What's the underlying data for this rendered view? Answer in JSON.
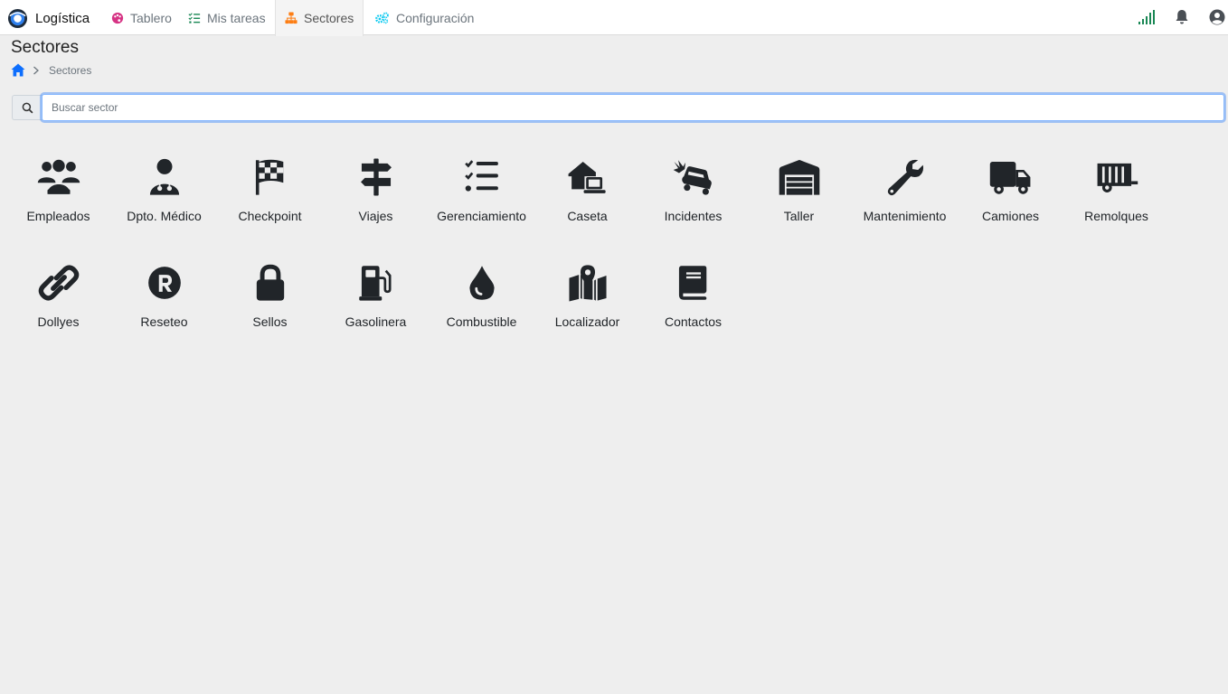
{
  "app": {
    "brand": "Logística",
    "colors": {
      "accent": "#0d6efd",
      "active_tab": "#fd7e14",
      "tablero": "#d63384",
      "tareas": "#198754",
      "config": "#0dcaf0"
    }
  },
  "nav": {
    "tabs": [
      {
        "label": "Tablero",
        "icon": "palette-icon"
      },
      {
        "label": "Mis tareas",
        "icon": "tasks-icon"
      },
      {
        "label": "Sectores",
        "icon": "sitemap-icon"
      },
      {
        "label": "Configuración",
        "icon": "cogs-icon"
      }
    ],
    "active": "Sectores"
  },
  "page": {
    "title": "Sectores",
    "breadcrumb": [
      "Sectores"
    ]
  },
  "search": {
    "placeholder": "Buscar sector",
    "value": ""
  },
  "sectors": [
    {
      "label": "Empleados",
      "icon": "users-icon"
    },
    {
      "label": "Dpto. Médico",
      "icon": "user-doctor-icon"
    },
    {
      "label": "Checkpoint",
      "icon": "flag-checkered-icon"
    },
    {
      "label": "Viajes",
      "icon": "signs-post-icon"
    },
    {
      "label": "Gerenciamiento",
      "icon": "list-check-icon"
    },
    {
      "label": "Caseta",
      "icon": "house-laptop-icon"
    },
    {
      "label": "Incidentes",
      "icon": "car-burst-icon"
    },
    {
      "label": "Taller",
      "icon": "warehouse-icon"
    },
    {
      "label": "Mantenimiento",
      "icon": "wrench-icon"
    },
    {
      "label": "Camiones",
      "icon": "truck-icon"
    },
    {
      "label": "Remolques",
      "icon": "trailer-icon"
    },
    {
      "label": "Dollyes",
      "icon": "link-icon"
    },
    {
      "label": "Reseteo",
      "icon": "registered-icon"
    },
    {
      "label": "Sellos",
      "icon": "lock-icon"
    },
    {
      "label": "Gasolinera",
      "icon": "gas-pump-icon"
    },
    {
      "label": "Combustible",
      "icon": "droplet-icon"
    },
    {
      "label": "Localizador",
      "icon": "map-location-icon"
    },
    {
      "label": "Contactos",
      "icon": "book-icon"
    }
  ]
}
